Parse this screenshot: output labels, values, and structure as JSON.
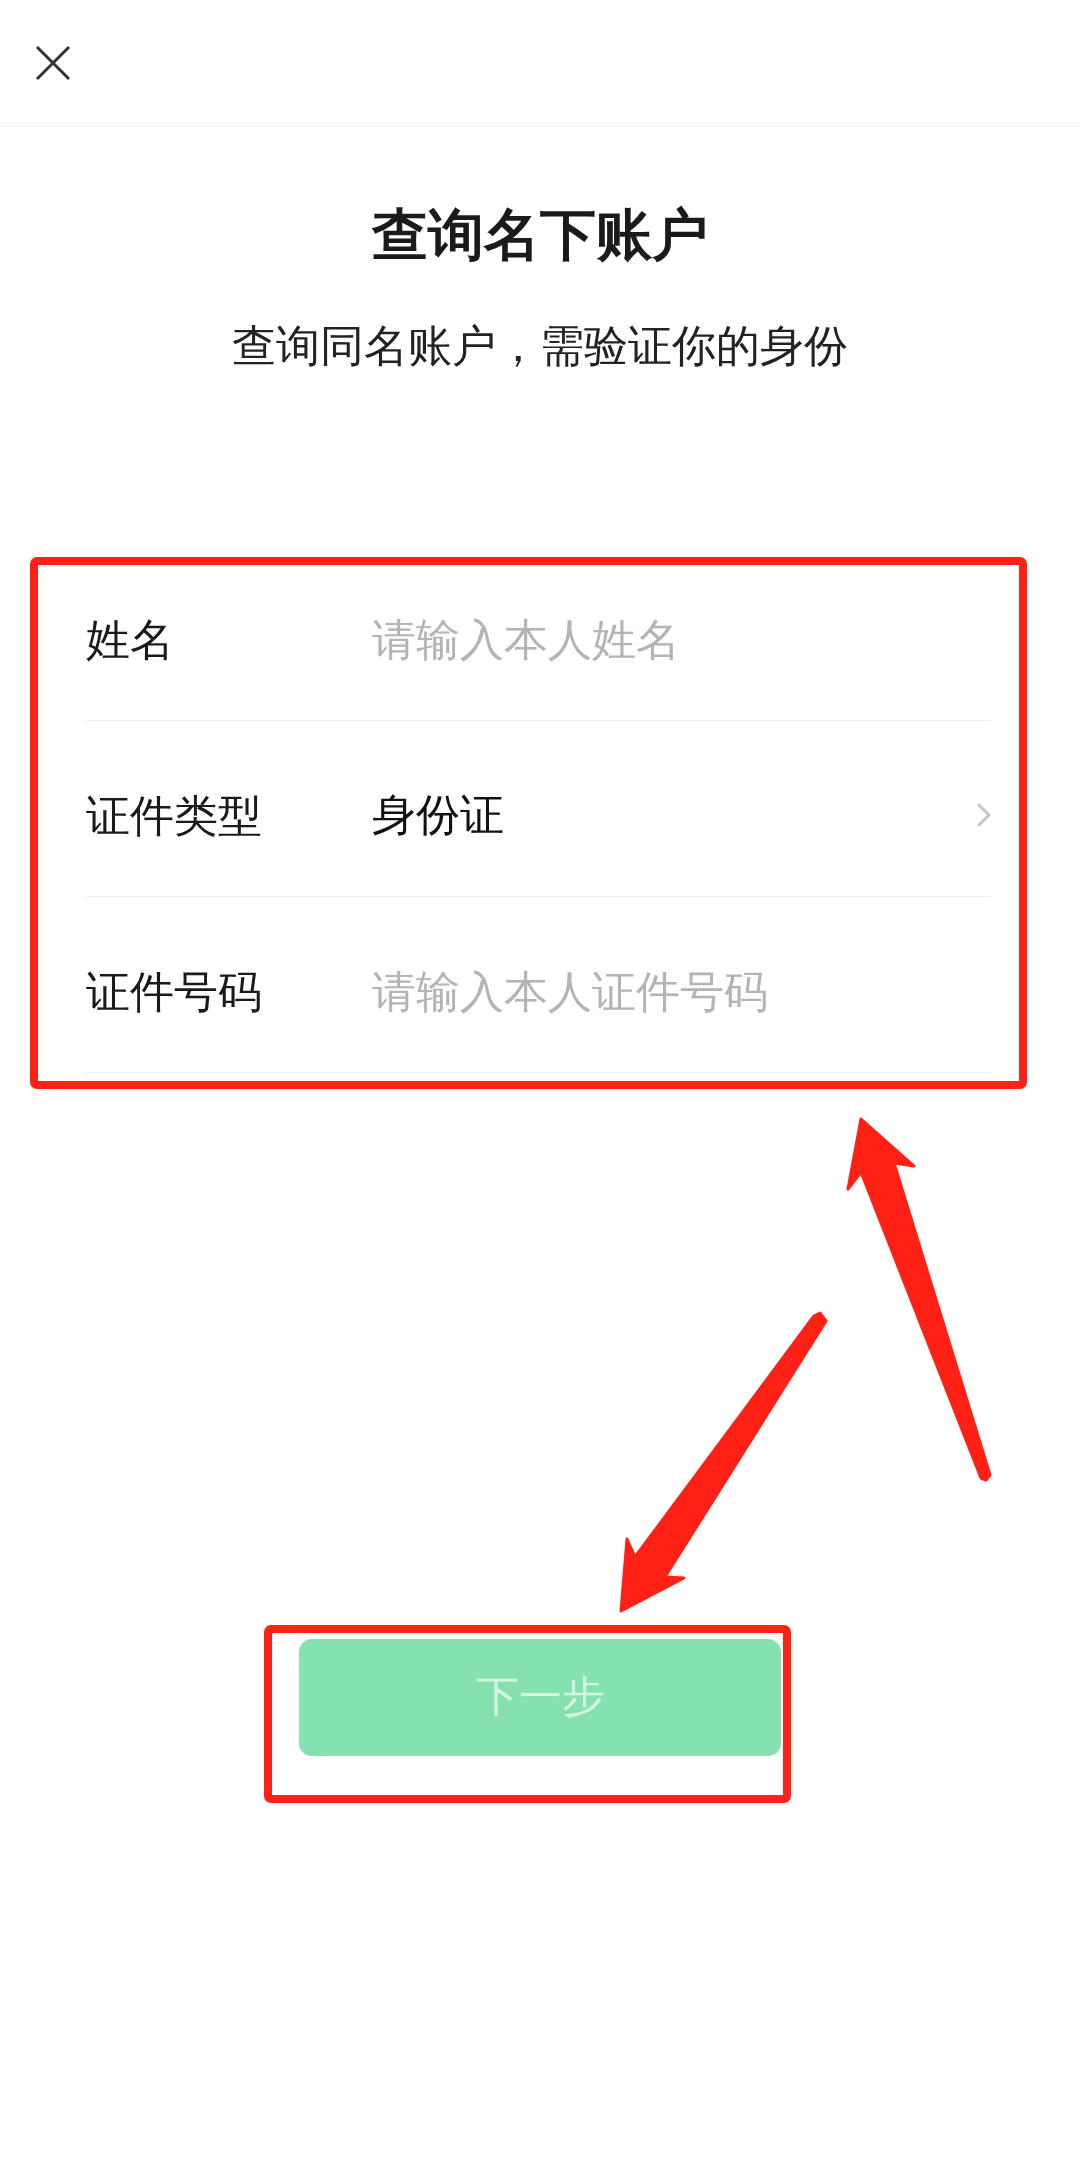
{
  "title": "查询名下账户",
  "subtitle": "查询同名账户，需验证你的身份",
  "form": {
    "highlighted": true,
    "rows": [
      {
        "kind": "input",
        "label": "姓名",
        "placeholder": "请输入本人姓名"
      },
      {
        "kind": "select",
        "label": "证件类型",
        "value": "身份证"
      },
      {
        "kind": "input",
        "label": "证件号码",
        "placeholder": "请输入本人证件号码"
      }
    ]
  },
  "next_button": {
    "label": "下一步",
    "disabled": true,
    "highlighted": true
  }
}
